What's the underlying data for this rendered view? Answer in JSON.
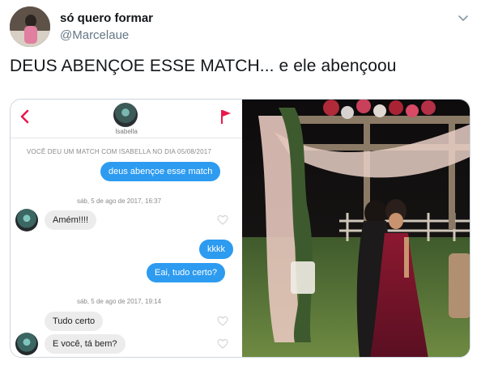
{
  "tweet": {
    "display_name": "só quero formar",
    "handle": "@Marcelaue",
    "text": "DEUS ABENÇOE ESSE MATCH... e ele abençoou"
  },
  "chat": {
    "match_name": "Isabella",
    "match_note": "VOCÊ DEU UM MATCH COM ISABELLA NO DIA 05/08/2017",
    "accent_color": "#e8194e",
    "bubble_color": "#2d9bf0",
    "messages": [
      {
        "text": "deus abençoe esse match"
      },
      {
        "date": "sáb, 5 de ago de 2017, 16:37"
      },
      {
        "text": "Amém!!!!"
      },
      {
        "text": "kkkk"
      },
      {
        "text": "Eai, tudo certo?"
      },
      {
        "date": "sáb, 5 de ago de 2017, 19:14"
      },
      {
        "text": "Tudo certo"
      },
      {
        "text": "E você, tá bem?"
      }
    ]
  }
}
